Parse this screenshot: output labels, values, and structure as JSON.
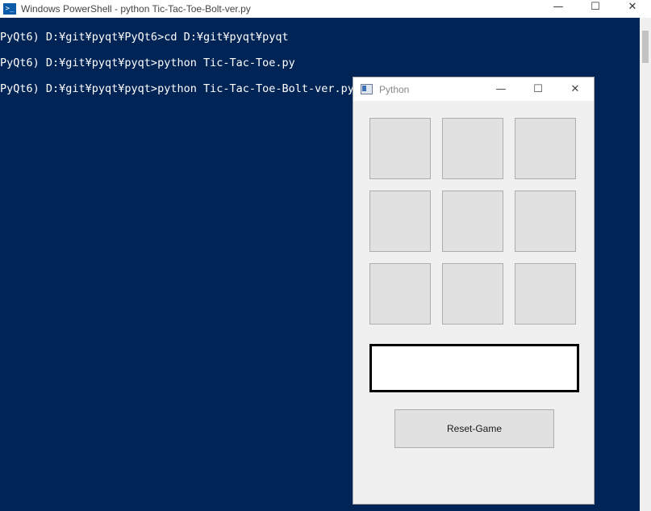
{
  "ps_window": {
    "title": "Windows PowerShell - python  Tic-Tac-Toe-Bolt-ver.py",
    "controls": {
      "minimize": "—",
      "maximize": "☐",
      "close": "✕"
    }
  },
  "console": {
    "lines": [
      "PyQt6) D:¥git¥pyqt¥PyQt6>cd D:¥git¥pyqt¥pyqt",
      "PyQt6) D:¥git¥pyqt¥pyqt>python Tic-Tac-Toe.py",
      "PyQt6) D:¥git¥pyqt¥pyqt>python Tic-Tac-Toe-Bolt-ver.py"
    ]
  },
  "py_window": {
    "title": "Python",
    "controls": {
      "minimize": "—",
      "maximize": "☐",
      "close": "✕"
    },
    "board": [
      "",
      "",
      "",
      "",
      "",
      "",
      "",
      "",
      ""
    ],
    "status_text": "",
    "reset_label": "Reset-Game"
  },
  "colors": {
    "console_bg": "#012456",
    "console_text": "#ffffff",
    "window_bg": "#f0f0f0",
    "cell_bg": "#e1e1e1"
  }
}
